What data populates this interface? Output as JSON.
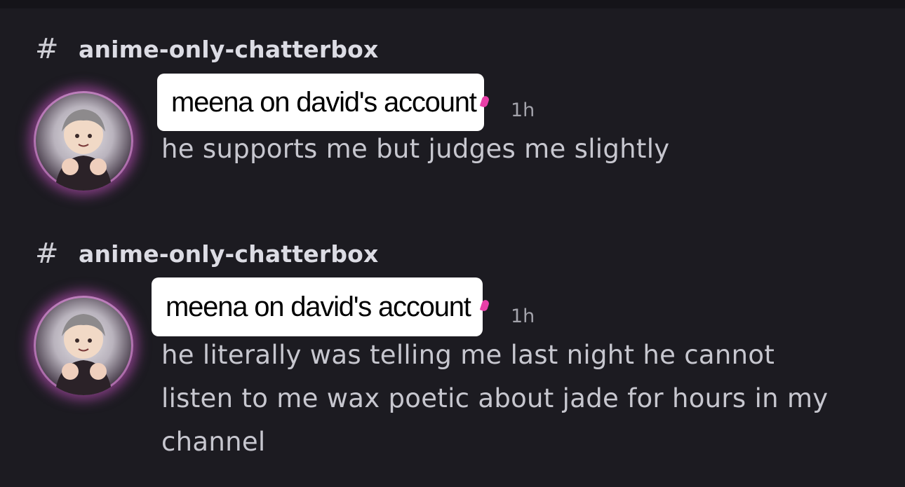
{
  "messages": [
    {
      "channel": "anime-only-chatterbox",
      "author": "meena on david's account",
      "time": "1h",
      "text": "he supports me but judges me slightly",
      "accent_color": "#e83fa8"
    },
    {
      "channel": "anime-only-chatterbox",
      "author": "meena on david's account",
      "time": "1h",
      "text": "he literally was telling me last night he cannot listen to me wax poetic about jade for hours in my channel",
      "accent_color": "#e83fa8"
    }
  ],
  "icons": {
    "channel": "hash-icon",
    "decoration": "heart-icon"
  }
}
